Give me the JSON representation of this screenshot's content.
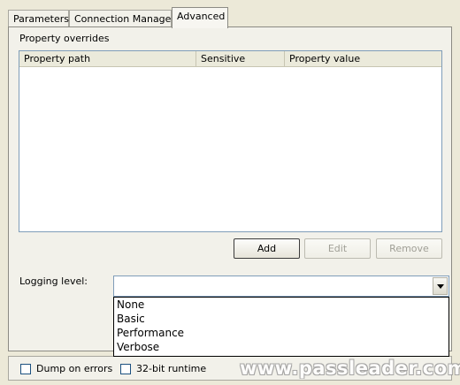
{
  "tabs": {
    "parameters": "Parameters",
    "connection_managers": "Connection Managers",
    "advanced": "Advanced"
  },
  "property_overrides": {
    "label": "Property overrides",
    "columns": [
      "Property path",
      "Sensitive",
      "Property value"
    ],
    "rows": []
  },
  "buttons": {
    "add": "Add",
    "edit": "Edit",
    "remove": "Remove"
  },
  "logging": {
    "label": "Logging level:",
    "value": "",
    "options": [
      "None",
      "Basic",
      "Performance",
      "Verbose"
    ]
  },
  "options": {
    "dump_on_errors": {
      "label": "Dump on errors",
      "checked": false
    },
    "runtime_32bit": {
      "label": "32-bit runtime",
      "checked": false
    }
  },
  "watermark": "www.passleader.com",
  "colors": {
    "dialog_bg": "#ece9d8",
    "list_border": "#7f9db9",
    "disabled_text": "#a09f96"
  }
}
